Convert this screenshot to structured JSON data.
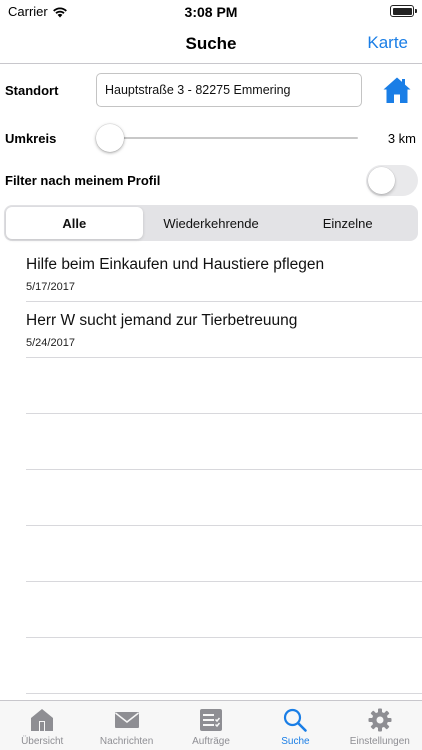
{
  "status_bar": {
    "carrier": "Carrier",
    "time": "3:08 PM"
  },
  "nav": {
    "title": "Suche",
    "action": "Karte"
  },
  "search": {
    "location_label": "Standort",
    "address_value": "Hauptstraße 3 - 82275 Emmering",
    "home_icon": "home-icon",
    "radius_label": "Umkreis",
    "radius_value": "3 km",
    "radius_slider_fraction": 0.0,
    "filter_label": "Filter nach meinem Profil",
    "filter_enabled": false
  },
  "segments": [
    {
      "label": "Alle",
      "active": true
    },
    {
      "label": "Wiederkehrende",
      "active": false
    },
    {
      "label": "Einzelne",
      "active": false
    }
  ],
  "results": [
    {
      "title": "Hilfe beim Einkaufen und Haustiere pflegen",
      "date": "5/17/2017"
    },
    {
      "title": "Herr W sucht jemand zur Tierbetreuung",
      "date": "5/24/2017"
    }
  ],
  "tabs": [
    {
      "label": "Übersicht",
      "icon": "house-icon",
      "active": false
    },
    {
      "label": "Nachrichten",
      "icon": "envelope-icon",
      "active": false
    },
    {
      "label": "Aufträge",
      "icon": "checklist-icon",
      "active": false
    },
    {
      "label": "Suche",
      "icon": "magnifier-icon",
      "active": true
    },
    {
      "label": "Einstellungen",
      "icon": "gear-icon",
      "active": false
    }
  ],
  "colors": {
    "accent": "#1a7ee6",
    "tab_inactive": "#8e8e93",
    "separator": "#c8c7cc"
  }
}
